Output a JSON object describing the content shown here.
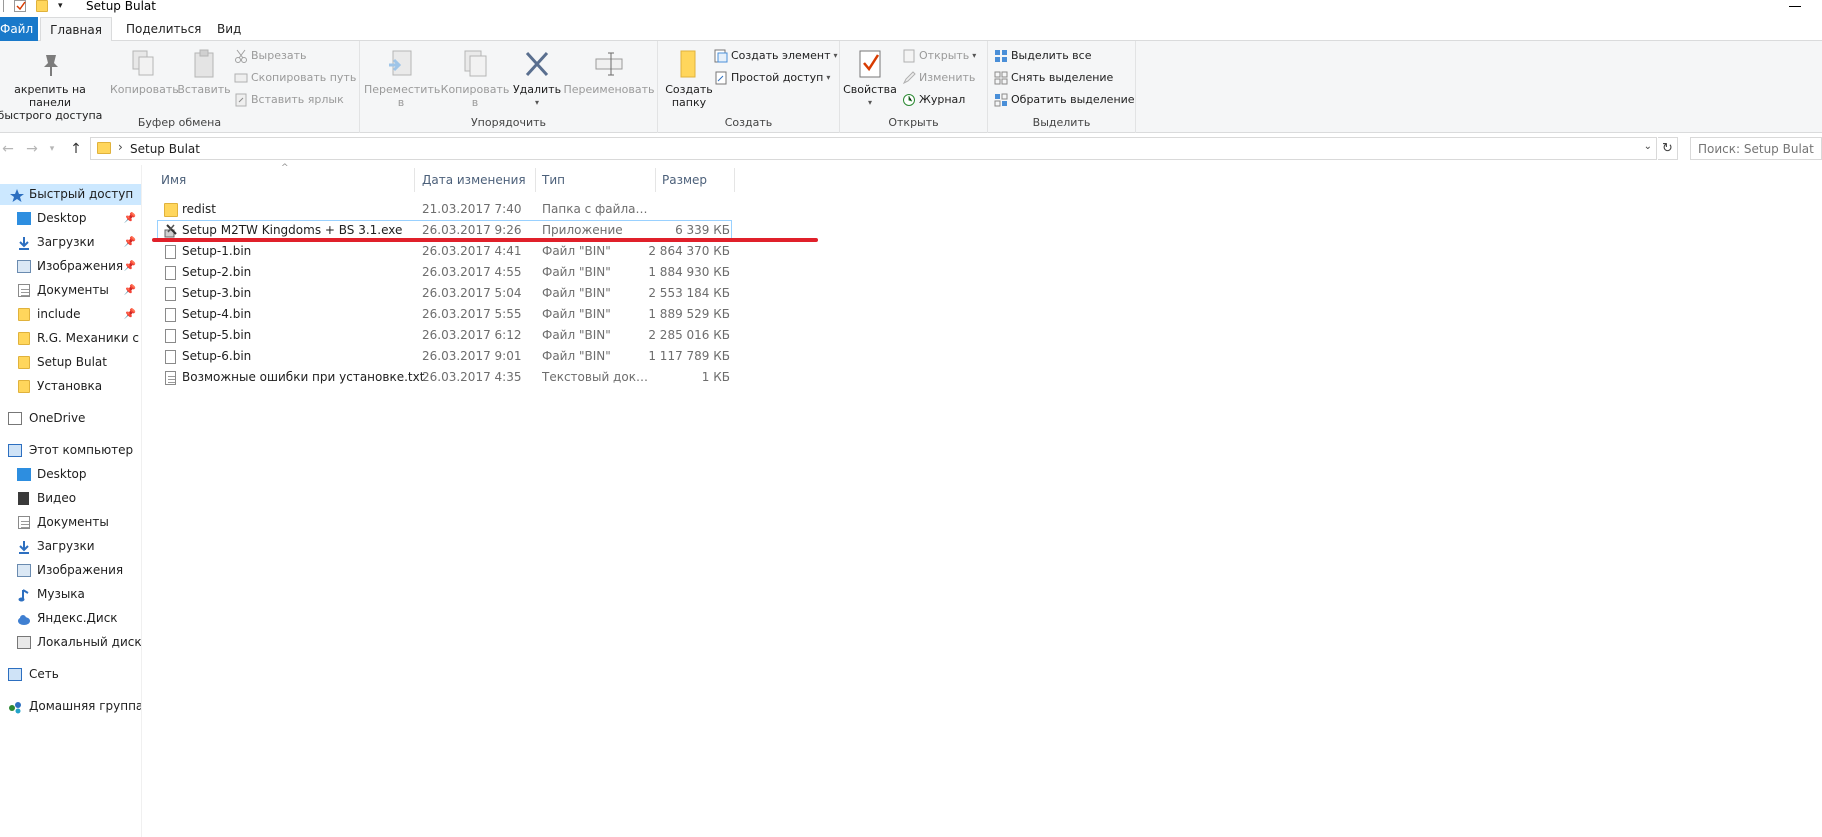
{
  "window": {
    "title": "Setup Bulat"
  },
  "ribbon_tabs": [
    "Файл",
    "Главная",
    "Поделиться",
    "Вид"
  ],
  "ribbon": {
    "clipboard": {
      "label": "Буфер обмена",
      "pin_line1": "акрепить на панели",
      "pin_line2": "быстрого доступа",
      "copy": "Копировать",
      "paste": "Вставить",
      "cut": "Вырезать",
      "copy_path": "Скопировать путь",
      "paste_shortcut": "Вставить ярлык"
    },
    "organize": {
      "label": "Упорядочить",
      "move_line1": "Переместить",
      "move_line2": "в",
      "copy_line1": "Копировать",
      "copy_line2": "в",
      "delete": "Удалить",
      "rename": "Переименовать"
    },
    "create": {
      "label": "Создать",
      "new_folder_line1": "Создать",
      "new_folder_line2": "папку",
      "new_item": "Создать элемент",
      "easy_access": "Простой доступ"
    },
    "open": {
      "label": "Открыть",
      "properties": "Свойства",
      "open": "Открыть",
      "edit": "Изменить",
      "history": "Журнал"
    },
    "select": {
      "label": "Выделить",
      "select_all": "Выделить все",
      "select_none": "Снять выделение",
      "invert": "Обратить выделение"
    }
  },
  "address": {
    "path": "Setup Bulat",
    "search_placeholder": "Поиск: Setup Bulat"
  },
  "nav": {
    "quick_access": "Быстрый доступ",
    "quick_items": [
      "Desktop",
      "Загрузки",
      "Изображения",
      "Документы",
      "include",
      "R.G. Механики с му",
      "Setup Bulat",
      "Установка"
    ],
    "onedrive": "OneDrive",
    "this_pc": "Этот компьютер",
    "pc_items": [
      "Desktop",
      "Видео",
      "Документы",
      "Загрузки",
      "Изображения",
      "Музыка",
      "Яндекс.Диск",
      "Локальный диск (C"
    ],
    "network": "Сеть",
    "homegroup": "Домашняя группа"
  },
  "columns": {
    "name": "Имя",
    "date": "Дата изменения",
    "type": "Тип",
    "size": "Размер"
  },
  "files": [
    {
      "name": "redist",
      "date": "21.03.2017 7:40",
      "type": "Папка с файлами",
      "size": ""
    },
    {
      "name": "Setup M2TW Kingdoms + BS 3.1.exe",
      "date": "26.03.2017 9:26",
      "type": "Приложение",
      "size": "6 339 КБ"
    },
    {
      "name": "Setup-1.bin",
      "date": "26.03.2017 4:41",
      "type": "Файл \"BIN\"",
      "size": "2 864 370 КБ"
    },
    {
      "name": "Setup-2.bin",
      "date": "26.03.2017 4:55",
      "type": "Файл \"BIN\"",
      "size": "1 884 930 КБ"
    },
    {
      "name": "Setup-3.bin",
      "date": "26.03.2017 5:04",
      "type": "Файл \"BIN\"",
      "size": "2 553 184 КБ"
    },
    {
      "name": "Setup-4.bin",
      "date": "26.03.2017 5:55",
      "type": "Файл \"BIN\"",
      "size": "1 889 529 КБ"
    },
    {
      "name": "Setup-5.bin",
      "date": "26.03.2017 6:12",
      "type": "Файл \"BIN\"",
      "size": "2 285 016 КБ"
    },
    {
      "name": "Setup-6.bin",
      "date": "26.03.2017 9:01",
      "type": "Файл \"BIN\"",
      "size": "1 117 789 КБ"
    },
    {
      "name": "Возможные ошибки при установке.txt",
      "date": "26.03.2017 4:35",
      "type": "Текстовый докум...",
      "size": "1 КБ"
    }
  ],
  "colors": {
    "accent": "#1979ca",
    "selection": "#cce8ff",
    "annotation": "#e0202a"
  }
}
